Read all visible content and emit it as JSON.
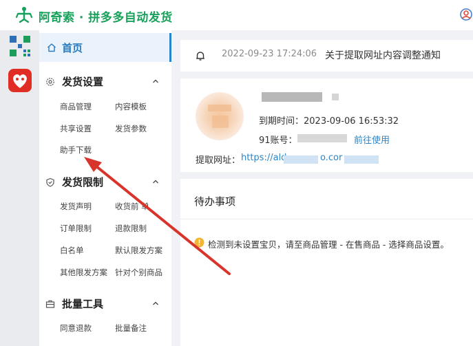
{
  "header": {
    "title": "阿奇索 · 拼多多自动发货"
  },
  "sidebar": {
    "home_label": "首页",
    "sections": [
      {
        "title": "发货设置",
        "items": [
          "商品管理",
          "内容模板",
          "共享设置",
          "发货参数",
          "助手下载"
        ]
      },
      {
        "title": "发货限制",
        "items": [
          "发货声明",
          "收货前   单",
          "订单限制",
          "退款限制",
          "白名单",
          "默认限发方案",
          "其他限发方案",
          "针对个别商品"
        ]
      },
      {
        "title": "批量工具",
        "items": [
          "同意退款",
          "批量备注"
        ]
      }
    ]
  },
  "notice": {
    "time": "2022-09-23 17:24:06",
    "text": "关于提取网址内容调整通知"
  },
  "account": {
    "expiry": "到期时间：2023-09-06 16:53:32",
    "account_label": "91账号：",
    "go_use": "前往使用",
    "url_label": "提取网址：",
    "url_start": "https://ald",
    "url_mid": "o.cor"
  },
  "todo": {
    "title": "待办事项",
    "warning": "检测到未设置宝贝，请至商品管理 - 在售商品 - 选择商品设置。"
  },
  "colors": {
    "brand_green": "#17a05a",
    "link_blue": "#2a84c8",
    "arrow_red": "#d9342b"
  }
}
